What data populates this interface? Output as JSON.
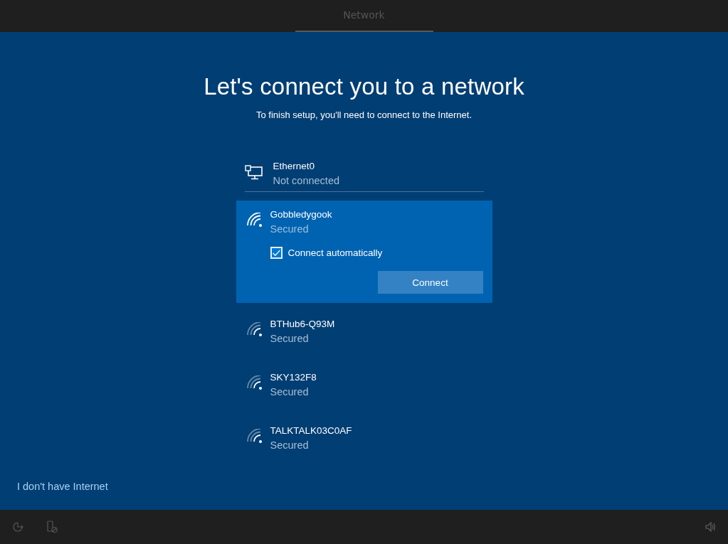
{
  "header": {
    "tab": {
      "label": "Network",
      "selected": true
    }
  },
  "title": "Let's connect you to a network",
  "subtitle": "To finish setup, you'll need to connect to the Internet.",
  "ethernet": {
    "name": "Ethernet0",
    "status": "Not connected"
  },
  "networks": [
    {
      "name": "Gobbledygook",
      "status": "Secured",
      "selected": true,
      "connect_automatically": {
        "label": "Connect automatically",
        "checked": true
      },
      "button": "Connect"
    },
    {
      "name": "BTHub6-Q93M",
      "status": "Secured",
      "selected": false
    },
    {
      "name": "SKY132F8",
      "status": "Secured",
      "selected": false
    },
    {
      "name": "TALKTALK03C0AF",
      "status": "Secured",
      "selected": false
    }
  ],
  "skip_link": "I don't have Internet"
}
